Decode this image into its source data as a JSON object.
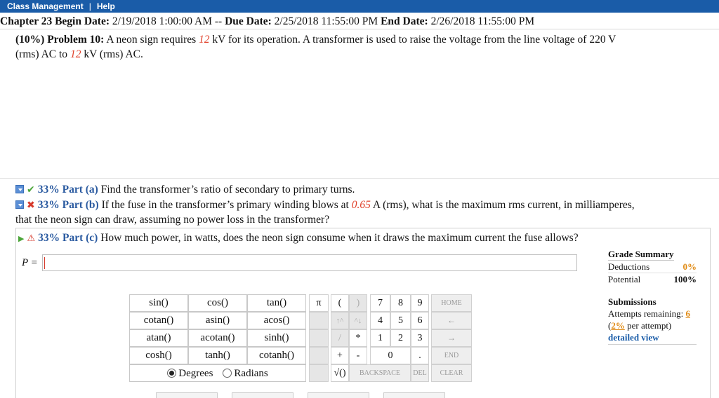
{
  "topbar": {
    "class_management": "Class Management",
    "separator": "|",
    "help": "Help"
  },
  "dates": {
    "chapter": "Chapter 23",
    "begin_label": "Begin Date:",
    "begin": "2/19/2018 1:00:00 AM",
    "dash": "--",
    "due_label": "Due Date:",
    "due": "2/25/2018 11:55:00 PM",
    "end_label": "End Date:",
    "end": "2/26/2018 11:55:00 PM"
  },
  "problem": {
    "head": "(10%) Problem 10:",
    "t1": "A neon sign requires",
    "v1": "12",
    "t2": "kV for its operation. A transformer is used to raise the voltage from the line voltage of 220 V (rms) AC to",
    "v2": "12",
    "t3": "kV (rms) AC."
  },
  "parts": {
    "a": {
      "pct": "33% Part (a)",
      "text": "Find the transformer’s ratio of secondary to primary turns."
    },
    "b": {
      "pct": "33% Part (b)",
      "t1": "If the fuse in the transformer’s primary winding blows at",
      "value": "0.65",
      "t2": "A (rms), what is the maximum rms current, in milliamperes,",
      "t3": "that the neon sign can draw, assuming no power loss in the transformer?"
    },
    "c": {
      "pct": "33% Part (c)",
      "text": "How much power, in watts, does the neon sign consume when it draws the maximum current the fuse allows?"
    }
  },
  "answer": {
    "label": "P =",
    "value": ""
  },
  "grade": {
    "title": "Grade Summary",
    "deductions_label": "Deductions",
    "deductions": "0%",
    "potential_label": "Potential",
    "potential": "100%"
  },
  "submissions": {
    "title": "Submissions",
    "attempts_label": "Attempts remaining:",
    "attempts": "6",
    "per_open": "(",
    "per_value": "2%",
    "per_text": "per attempt)",
    "detail": "detailed view"
  },
  "functions": [
    [
      "sin()",
      "cos()",
      "tan()"
    ],
    [
      "cotan()",
      "asin()",
      "acos()"
    ],
    [
      "atan()",
      "acotan()",
      "sinh()"
    ],
    [
      "cosh()",
      "tanh()",
      "cotanh()"
    ]
  ],
  "modes": {
    "degrees": "Degrees",
    "radians": "Radians",
    "selected": "Degrees"
  },
  "keys": {
    "pi": "π",
    "lparen": "(",
    "rparen": ")",
    "up": "↑^",
    "down": "^↓",
    "slash": "/",
    "star": "*",
    "plus": "+",
    "minus": "-",
    "sqrt": "√()",
    "d7": "7",
    "d8": "8",
    "d9": "9",
    "d4": "4",
    "d5": "5",
    "d6": "6",
    "d1": "1",
    "d2": "2",
    "d3": "3",
    "d0": "0",
    "dot": ".",
    "home": "HOME",
    "left": "←",
    "right": "→",
    "end": "END",
    "backspace": "BACKSPACE",
    "del": "DEL",
    "clear": "CLEAR"
  },
  "colors": {
    "topbar": "#1a5ca8",
    "value_red": "#e0402a",
    "part_blue": "#2a5aa0",
    "orange": "#e08b16"
  }
}
